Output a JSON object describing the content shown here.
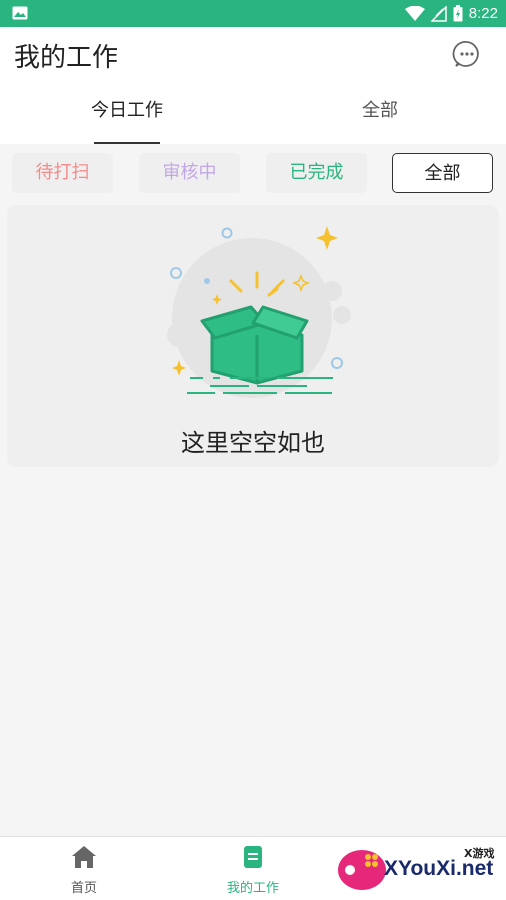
{
  "status_bar": {
    "time": "8:22"
  },
  "header": {
    "title": "我的工作"
  },
  "tabs": [
    {
      "label": "今日工作",
      "active": true
    },
    {
      "label": "全部",
      "active": false
    }
  ],
  "filters": [
    {
      "label": "待打扫",
      "color": "#f28c8c"
    },
    {
      "label": "审核中",
      "color": "#c3a7e5"
    },
    {
      "label": "已完成",
      "color": "#2ab47f"
    },
    {
      "label": "全部",
      "selected": true
    }
  ],
  "empty_state": {
    "message": "这里空空如也"
  },
  "bottom_nav": [
    {
      "label": "首页",
      "icon": "home-icon",
      "active": false
    },
    {
      "label": "我的工作",
      "icon": "document-icon",
      "active": true
    }
  ],
  "watermark": {
    "small": "X游戏",
    "big": "XYouXi.net"
  },
  "colors": {
    "brand": "#2ab47f",
    "background": "#f5f5f5"
  }
}
